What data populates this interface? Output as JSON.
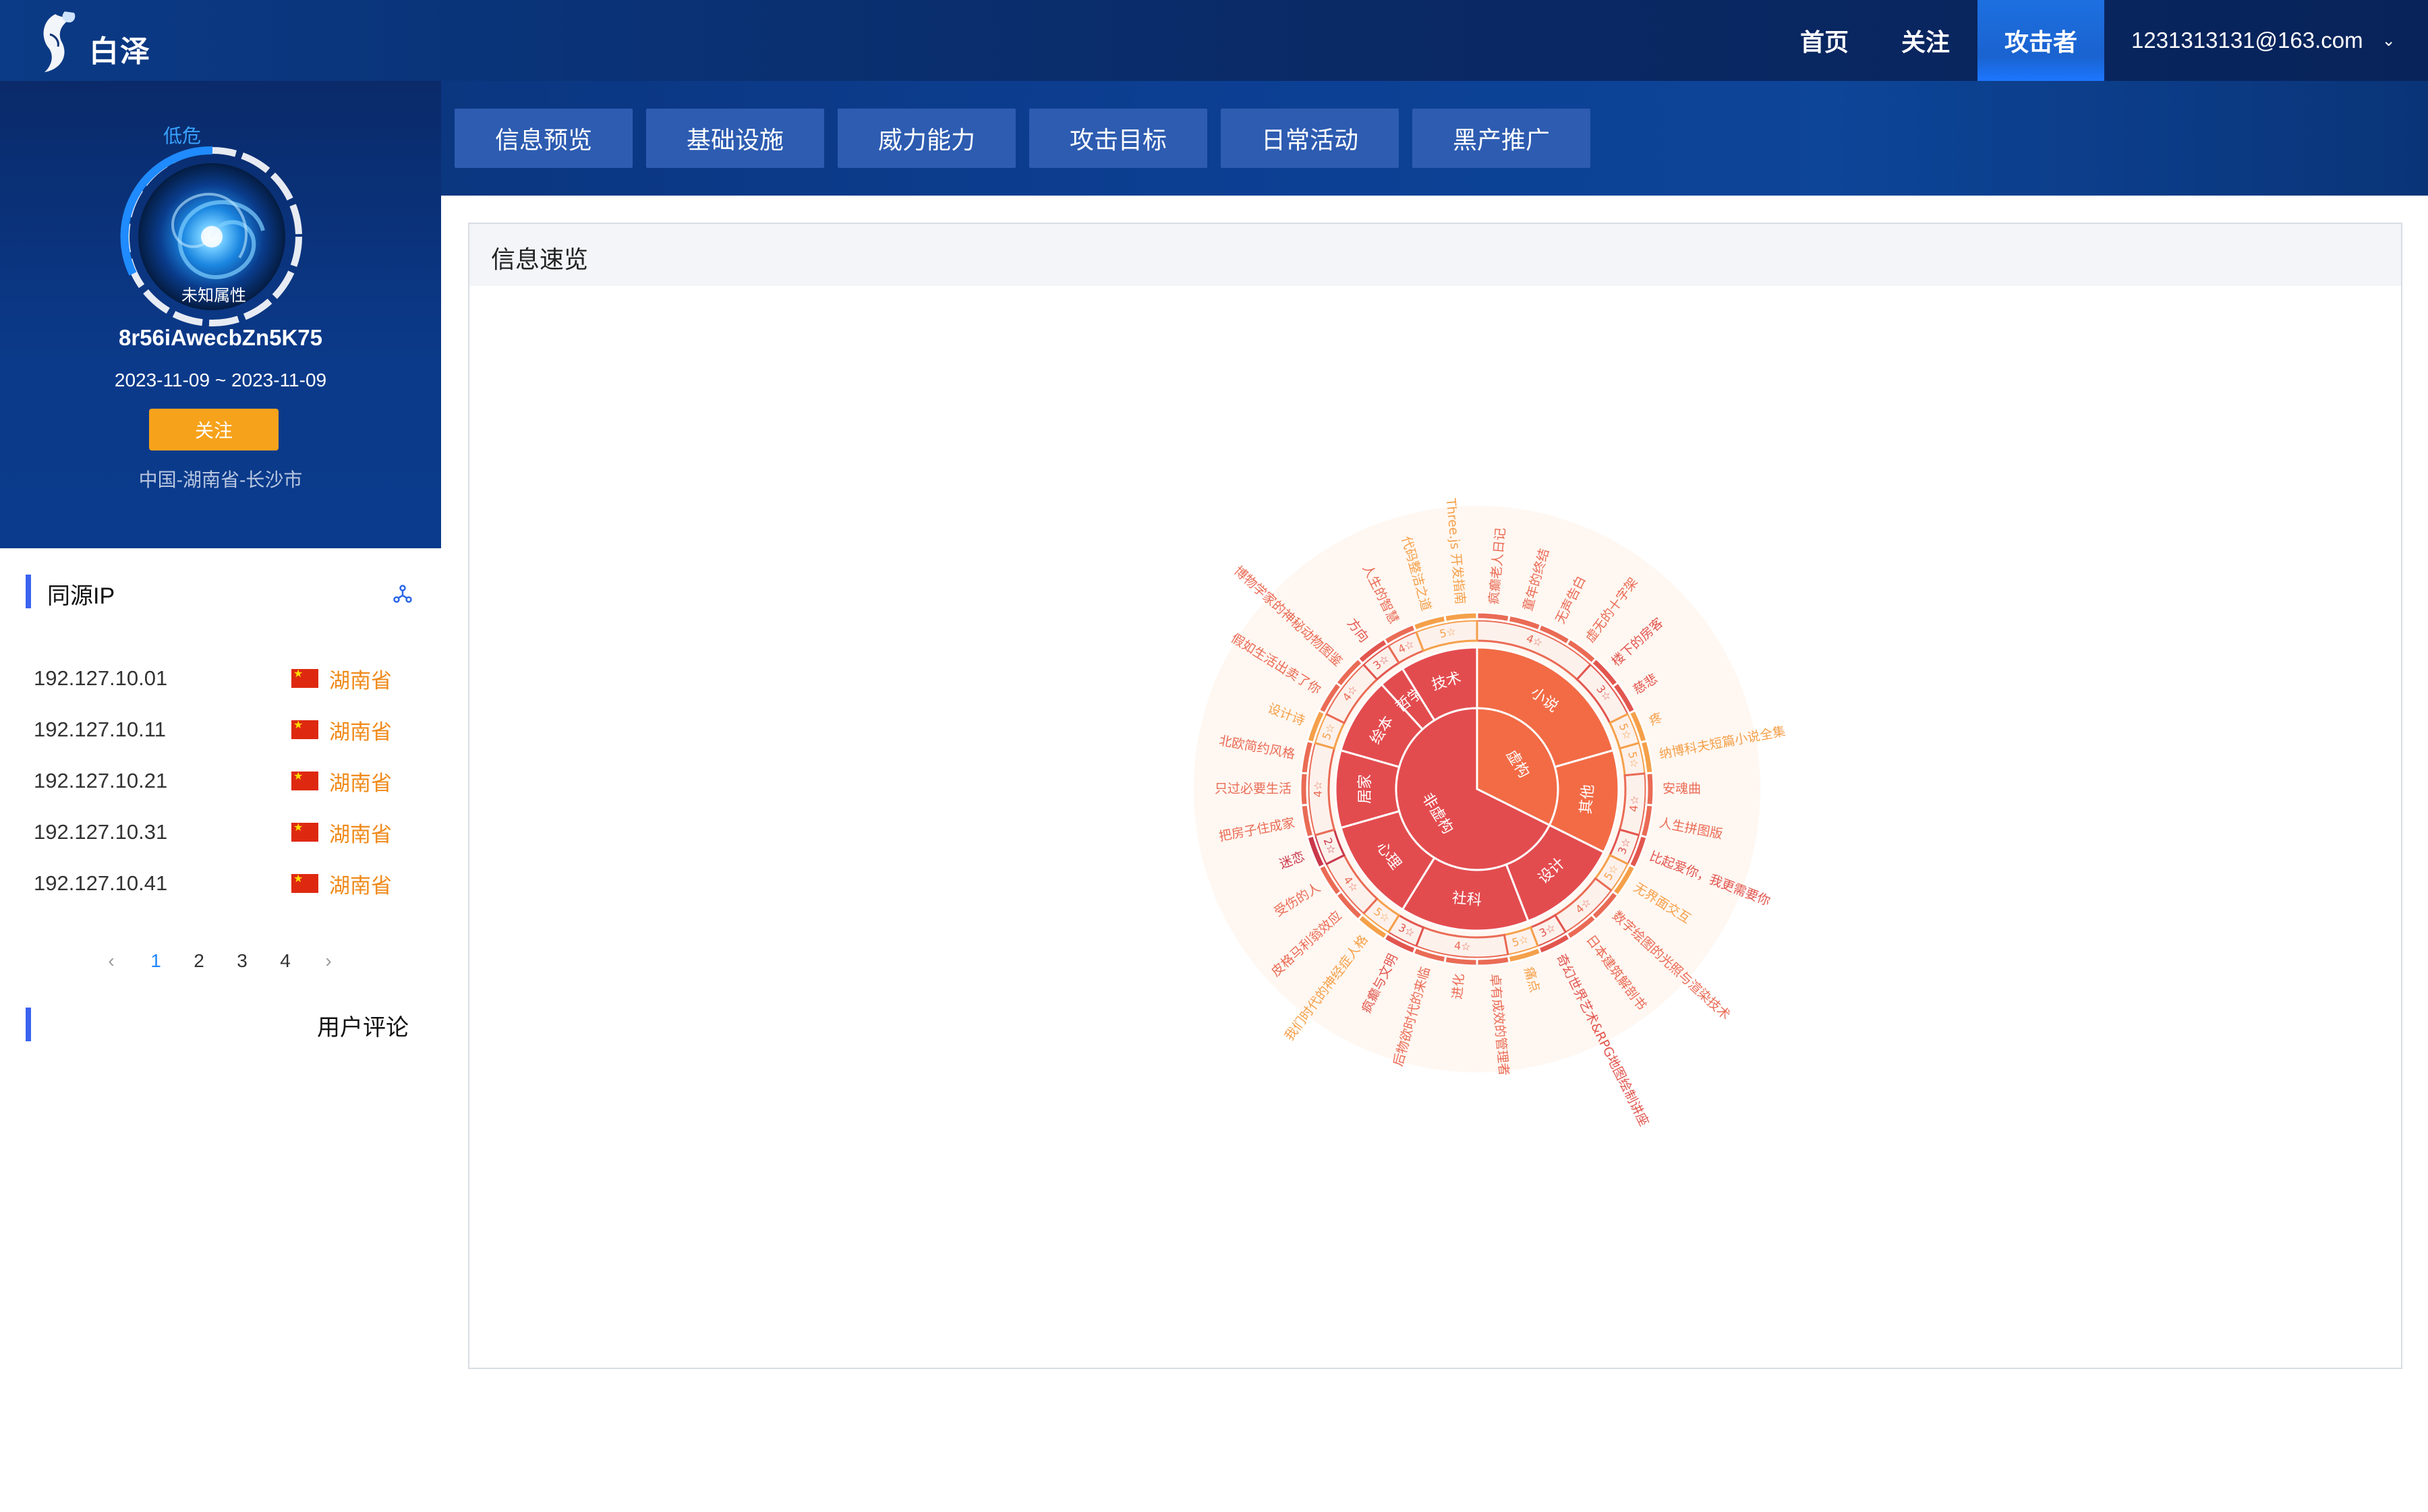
{
  "header": {
    "brand": "白泽",
    "nav": [
      {
        "label": "首页",
        "active": false
      },
      {
        "label": "关注",
        "active": false
      },
      {
        "label": "攻击者",
        "active": true
      }
    ],
    "user_email": "1231313131@163.com",
    "user_chevron": "⌄"
  },
  "profile": {
    "risk_level": "低危",
    "avatar_tag": "未知属性",
    "name": "8r56iAwecbZn5K75",
    "date_range": "2023-11-09 ~ 2023-11-09",
    "follow_label": "关注",
    "location": "中国-湖南省-长沙市"
  },
  "tabs": [
    {
      "label": "信息预览"
    },
    {
      "label": "基础设施"
    },
    {
      "label": "威力能力"
    },
    {
      "label": "攻击目标"
    },
    {
      "label": "日常活动"
    },
    {
      "label": "黑产推广"
    }
  ],
  "same_source": {
    "title": "同源IP",
    "rows": [
      {
        "ip": "192.127.10.01",
        "province": "湖南省"
      },
      {
        "ip": "192.127.10.11",
        "province": "湖南省"
      },
      {
        "ip": "192.127.10.21",
        "province": "湖南省"
      },
      {
        "ip": "192.127.10.31",
        "province": "湖南省"
      },
      {
        "ip": "192.127.10.41",
        "province": "湖南省"
      }
    ],
    "pagination": {
      "prev": "‹",
      "pages": [
        "1",
        "2",
        "3",
        "4"
      ],
      "current": "1",
      "next": "›"
    }
  },
  "comments": {
    "title": "用户评论"
  },
  "panel": {
    "title": "信息速览"
  },
  "chart_data": {
    "type": "sunburst",
    "root": [
      {
        "name": "虚构",
        "children": [
          {
            "name": "小说",
            "children": [
              {
                "name": "4☆",
                "leaves": [
                  "疯癫老人日记",
                  "童年的终结",
                  "无声告白",
                  "虚无的十字架"
                ]
              },
              {
                "name": "3☆",
                "leaves": [
                  "楼下的房客",
                  "慈悲"
                ]
              },
              {
                "name": "5☆",
                "leaves": [
                  "疼"
                ]
              }
            ]
          },
          {
            "name": "其他",
            "children": [
              {
                "name": "5☆",
                "leaves": [
                  "纳博科夫短篇小说全集"
                ]
              },
              {
                "name": "4☆",
                "leaves": [
                  "安魂曲",
                  "人生拼图版"
                ]
              },
              {
                "name": "3☆",
                "leaves": [
                  "比起爱你，我更需要你"
                ]
              }
            ]
          }
        ]
      },
      {
        "name": "非虚构",
        "children": [
          {
            "name": "设计",
            "children": [
              {
                "name": "5☆",
                "leaves": [
                  "无界面交互"
                ]
              },
              {
                "name": "4☆",
                "leaves": [
                  "数字绘图的光照与渲染技术",
                  "日本建筑解剖书"
                ]
              },
              {
                "name": "3☆",
                "leaves": [
                  "奇幻世界艺术&RPG地图绘制讲座"
                ]
              }
            ]
          },
          {
            "name": "社科",
            "children": [
              {
                "name": "5☆",
                "leaves": [
                  "痛点"
                ]
              },
              {
                "name": "4☆",
                "leaves": [
                  "卓有成效的管理者",
                  "进化",
                  "后物欲时代的来临"
                ]
              },
              {
                "name": "3☆",
                "leaves": [
                  "疯癫与文明"
                ]
              }
            ]
          },
          {
            "name": "心理",
            "children": [
              {
                "name": "5☆",
                "leaves": [
                  "我们时代的神经症人格"
                ]
              },
              {
                "name": "4☆",
                "leaves": [
                  "皮格马利翁效应",
                  "受伤的人"
                ]
              },
              {
                "name": "2☆",
                "leaves": [
                  "迷恋"
                ]
              }
            ]
          },
          {
            "name": "居家",
            "children": [
              {
                "name": "4☆",
                "leaves": [
                  "把房子住成家",
                  "只过必要生活",
                  "北欧简约风格"
                ]
              }
            ]
          },
          {
            "name": "绘本",
            "children": [
              {
                "name": "5☆",
                "leaves": [
                  "设计诗"
                ]
              },
              {
                "name": "4☆",
                "leaves": [
                  "假如生活出卖了你",
                  "博物学家的神秘动物图鉴"
                ]
              }
            ]
          },
          {
            "name": "哲学",
            "children": [
              {
                "name": "3☆",
                "leaves": [
                  "方向"
                ]
              }
            ]
          },
          {
            "name": "技术",
            "children": [
              {
                "name": "4☆",
                "leaves": [
                  "人生的智慧"
                ]
              },
              {
                "name": "5☆",
                "leaves": [
                  "代码整洁之道",
                  "Three.js 开发指南"
                ]
              }
            ]
          }
        ]
      }
    ]
  }
}
